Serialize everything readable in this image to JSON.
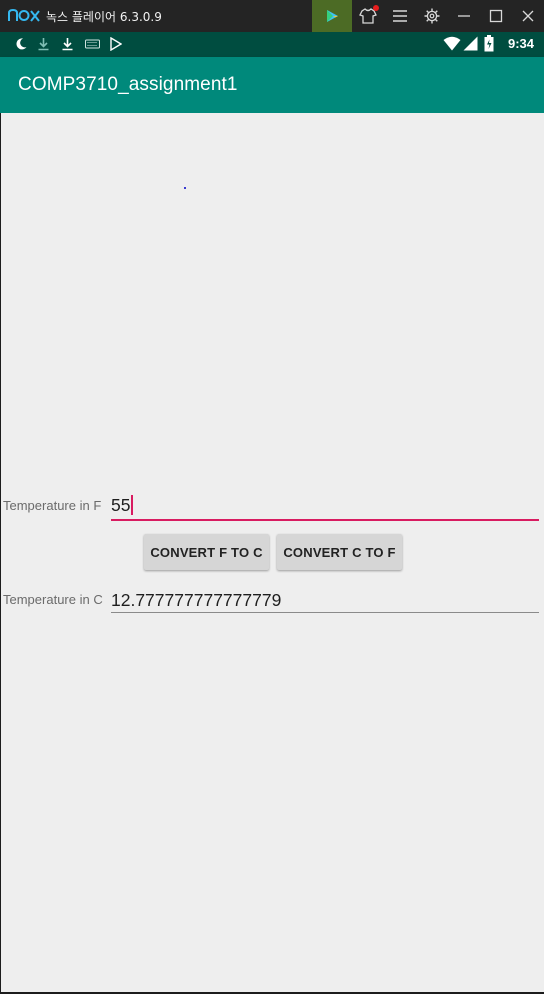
{
  "emulator": {
    "title": "녹스 플레이어 6.3.0.9",
    "icons": [
      "nox-logo-icon",
      "play-store-icon",
      "tshirt-icon",
      "menu-icon",
      "gear-icon",
      "minimize-icon",
      "maximize-icon",
      "close-icon"
    ]
  },
  "status_bar": {
    "time": "9:34",
    "icons": [
      "moon-icon",
      "download-icon",
      "download-icon",
      "keyboard-icon",
      "play-store-icon",
      "wifi-icon",
      "signal-icon",
      "battery-icon"
    ]
  },
  "toolbar": {
    "title": "COMP3710_assignment1"
  },
  "form": {
    "fahrenheit_label": "Temperature in F",
    "fahrenheit_value": "55",
    "convert_f_to_c_label": "CONVERT F TO C",
    "convert_c_to_f_label": "CONVERT C TO F",
    "celsius_label": "Temperature in C",
    "celsius_value": "12.777777777777779"
  },
  "colors": {
    "toolbar": "#00897b",
    "status_bar": "#004d40",
    "accent": "#d81b60",
    "background": "#eeeeee"
  }
}
